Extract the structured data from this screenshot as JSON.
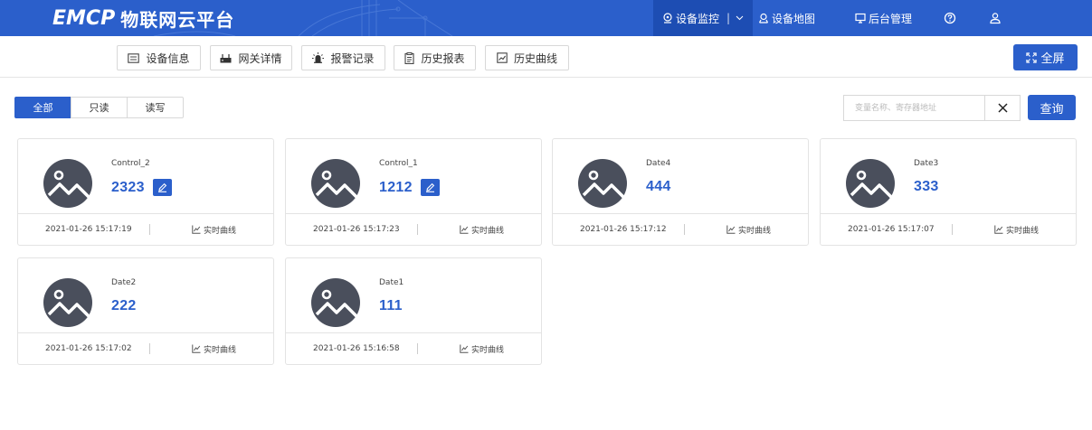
{
  "header": {
    "logo_text": "EMCP",
    "title": "物联网云平台",
    "nav": {
      "monitor": "设备监控",
      "monitor_sep": "|",
      "map": "设备地图",
      "admin": "后台管理"
    }
  },
  "toolbar": {
    "tabs": [
      "设备信息",
      "网关详情",
      "报警记录",
      "历史报表",
      "历史曲线"
    ],
    "fullscreen_label": "全屏"
  },
  "filter": {
    "segments": [
      "全部",
      "只读",
      "读写"
    ],
    "active_segment": "全部",
    "search_placeholder": "变量名称、寄存器地址",
    "search_value": "",
    "query_label": "查询"
  },
  "cards": [
    {
      "name": "Control_2",
      "value": "2323",
      "editable": true,
      "time": "2021-01-26 15:17:19",
      "curve_label": "实时曲线"
    },
    {
      "name": "Control_1",
      "value": "1212",
      "editable": true,
      "time": "2021-01-26 15:17:23",
      "curve_label": "实时曲线"
    },
    {
      "name": "Date4",
      "value": "444",
      "editable": false,
      "time": "2021-01-26 15:17:12",
      "curve_label": "实时曲线"
    },
    {
      "name": "Date3",
      "value": "333",
      "editable": false,
      "time": "2021-01-26 15:17:07",
      "curve_label": "实时曲线"
    },
    {
      "name": "Date2",
      "value": "222",
      "editable": false,
      "time": "2021-01-26 15:17:02",
      "curve_label": "实时曲线"
    },
    {
      "name": "Date1",
      "value": "111",
      "editable": false,
      "time": "2021-01-26 15:16:58",
      "curve_label": "实时曲线"
    }
  ],
  "colors": {
    "primary": "#2b5fcb",
    "primary_dark": "#1d4db3",
    "avatar": "#4a4f5c",
    "border": "#e3e3e3"
  },
  "icons": {
    "nav_monitor": "monitor-icon",
    "nav_map": "location-icon",
    "nav_admin": "admin-screen-icon",
    "help": "help-icon",
    "user": "user-icon",
    "tabs": [
      "info-icon",
      "gateway-icon",
      "alarm-icon",
      "report-icon",
      "chart-icon"
    ],
    "fullscreen": "fullscreen-icon",
    "clear": "close-icon",
    "card_avatar": "image-placeholder-icon",
    "card_edit": "edit-icon",
    "card_curve": "line-chart-icon"
  }
}
